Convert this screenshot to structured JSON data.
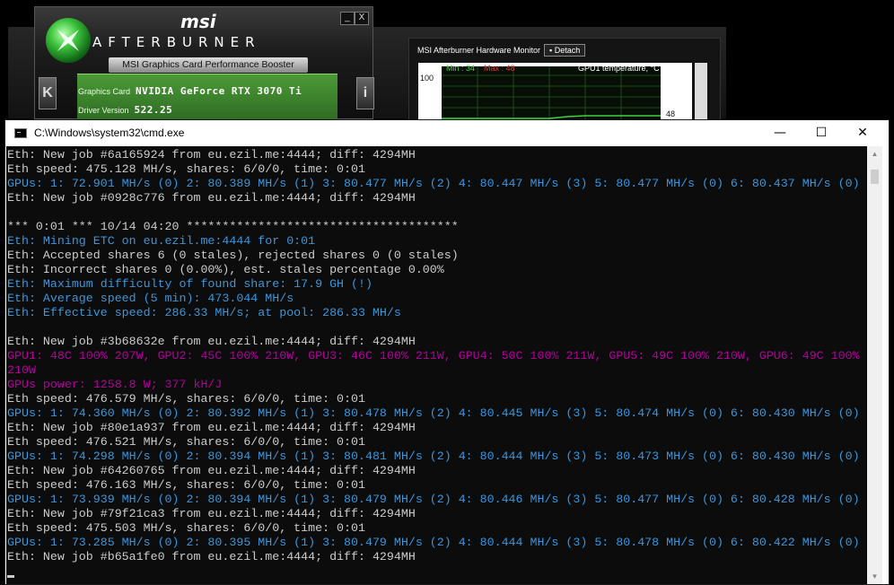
{
  "afterburner": {
    "brand": "msi",
    "title": "Afterburner",
    "subtitle": "MSI Graphics Card Performance Booster",
    "graphics_card_label": "Graphics Card",
    "graphics_card_value": "NVIDIA GeForce RTX 3070 Ti",
    "driver_label": "Driver Version",
    "driver_value": "522.25",
    "minimize_glyph": "_",
    "close_glyph": "X",
    "left_button_glyph": "K",
    "info_button_glyph": "i"
  },
  "hardware_monitor": {
    "title": "MSI Afterburner Hardware Monitor",
    "detach_label": "Detach",
    "min_text": "Min : 34",
    "max_text": "Max : 48",
    "graph_label": "GPU1 temperature, °C",
    "scale_top": "100",
    "current_value": "48"
  },
  "cmd": {
    "title": "C:\\Windows\\system32\\cmd.exe",
    "minimize_glyph": "—",
    "maximize_glyph": "☐",
    "close_glyph": "✕",
    "lines": [
      {
        "text": "Eth: New job #6a165924 from eu.ezil.me:4444; diff: 4294MH",
        "color": "white"
      },
      {
        "text": "Eth speed: 475.128 MH/s, shares: 6/0/0, time: 0:01",
        "color": "white"
      },
      {
        "text": "GPUs: 1: 72.901 MH/s (0) 2: 80.389 MH/s (1) 3: 80.477 MH/s (2) 4: 80.447 MH/s (3) 5: 80.477 MH/s (0) 6: 80.437 MH/s (0)",
        "color": "cyan"
      },
      {
        "text": "Eth: New job #0928c776 from eu.ezil.me:4444; diff: 4294MH",
        "color": "white"
      },
      {
        "text": "",
        "color": "white"
      },
      {
        "text": "*** 0:01 *** 10/14 04:20 **************************************",
        "color": "white"
      },
      {
        "text": "Eth: Mining ETC on eu.ezil.me:4444 for 0:01",
        "color": "cyan"
      },
      {
        "text": "Eth: Accepted shares 6 (0 stales), rejected shares 0 (0 stales)",
        "color": "white"
      },
      {
        "text": "Eth: Incorrect shares 0 (0.00%), est. stales percentage 0.00%",
        "color": "white"
      },
      {
        "text": "Eth: Maximum difficulty of found share: 17.9 GH (!)",
        "color": "cyan"
      },
      {
        "text": "Eth: Average speed (5 min): 473.044 MH/s",
        "color": "cyan"
      },
      {
        "text": "Eth: Effective speed: 286.33 MH/s; at pool: 286.33 MH/s",
        "color": "cyan"
      },
      {
        "text": "",
        "color": "white"
      },
      {
        "text": "Eth: New job #3b68632e from eu.ezil.me:4444; diff: 4294MH",
        "color": "white"
      },
      {
        "text": "GPU1: 48C 100% 207W, GPU2: 45C 100% 210W, GPU3: 46C 100% 211W, GPU4: 50C 100% 211W, GPU5: 49C 100% 210W, GPU6: 49C 100%",
        "color": "magenta"
      },
      {
        "text": "210W",
        "color": "magenta"
      },
      {
        "text": "GPUs power: 1258.8 W; 377 kH/J",
        "color": "magenta"
      },
      {
        "text": "Eth speed: 476.579 MH/s, shares: 6/0/0, time: 0:01",
        "color": "white"
      },
      {
        "text": "GPUs: 1: 74.360 MH/s (0) 2: 80.392 MH/s (1) 3: 80.478 MH/s (2) 4: 80.445 MH/s (3) 5: 80.474 MH/s (0) 6: 80.430 MH/s (0)",
        "color": "cyan"
      },
      {
        "text": "Eth: New job #80e1a937 from eu.ezil.me:4444; diff: 4294MH",
        "color": "white"
      },
      {
        "text": "Eth speed: 476.521 MH/s, shares: 6/0/0, time: 0:01",
        "color": "white"
      },
      {
        "text": "GPUs: 1: 74.298 MH/s (0) 2: 80.394 MH/s (1) 3: 80.481 MH/s (2) 4: 80.444 MH/s (3) 5: 80.473 MH/s (0) 6: 80.430 MH/s (0)",
        "color": "cyan"
      },
      {
        "text": "Eth: New job #64260765 from eu.ezil.me:4444; diff: 4294MH",
        "color": "white"
      },
      {
        "text": "Eth speed: 476.163 MH/s, shares: 6/0/0, time: 0:01",
        "color": "white"
      },
      {
        "text": "GPUs: 1: 73.939 MH/s (0) 2: 80.394 MH/s (1) 3: 80.479 MH/s (2) 4: 80.446 MH/s (3) 5: 80.477 MH/s (0) 6: 80.428 MH/s (0)",
        "color": "cyan"
      },
      {
        "text": "Eth: New job #79f21ca3 from eu.ezil.me:4444; diff: 4294MH",
        "color": "white"
      },
      {
        "text": "Eth speed: 475.503 MH/s, shares: 6/0/0, time: 0:01",
        "color": "white"
      },
      {
        "text": "GPUs: 1: 73.285 MH/s (0) 2: 80.395 MH/s (1) 3: 80.479 MH/s (2) 4: 80.444 MH/s (3) 5: 80.478 MH/s (0) 6: 80.422 MH/s (0)",
        "color": "cyan"
      },
      {
        "text": "Eth: New job #b65a1fe0 from eu.ezil.me:4444; diff: 4294MH",
        "color": "white"
      }
    ]
  },
  "colors": {
    "console_bg": "#0c0c0c",
    "white": "#cccccc",
    "cyan": "#3a96dd",
    "magenta": "#b4009e",
    "afterburner_green": "#3c8a2c"
  }
}
